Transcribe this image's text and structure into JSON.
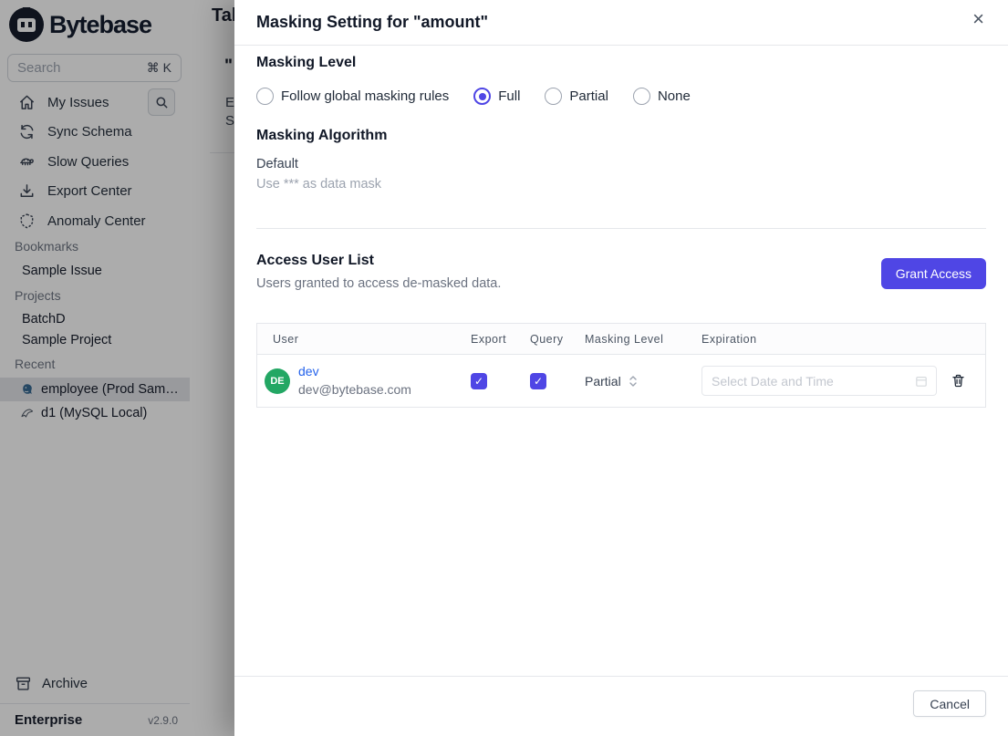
{
  "app": {
    "brand": "Bytebase",
    "plan": "Enterprise",
    "version": "v2.9.0"
  },
  "colors": {
    "accent": "#4f46e5",
    "link_blue": "#2563eb",
    "avatar_green": "#23a764",
    "postgres_blue": "#336791"
  },
  "sidebar": {
    "search": {
      "placeholder": "Search",
      "shortcut": "⌘ K"
    },
    "nav": [
      {
        "label": "My Issues",
        "icon": "home-icon"
      },
      {
        "label": "Sync Schema",
        "icon": "sync-icon"
      },
      {
        "label": "Slow Queries",
        "icon": "turtle-icon"
      },
      {
        "label": "Export Center",
        "icon": "download-icon"
      },
      {
        "label": "Anomaly Center",
        "icon": "shield-icon"
      }
    ],
    "sections": [
      {
        "title": "Bookmarks",
        "items": [
          {
            "label": "Sample Issue"
          }
        ]
      },
      {
        "title": "Projects",
        "items": [
          {
            "label": "BatchD"
          },
          {
            "label": "Sample Project"
          }
        ]
      },
      {
        "title": "Recent",
        "items": [
          {
            "label": "employee (Prod Sam…",
            "icon": "postgres-icon",
            "selected": true
          },
          {
            "label": "d1 (MySQL Local)",
            "icon": "mysql-icon",
            "selected": false
          }
        ]
      }
    ],
    "archive_label": "Archive"
  },
  "background_page": {
    "title_fragment": "Tab",
    "quote_fragment": "\"",
    "row_fragments": [
      "E",
      "S"
    ]
  },
  "modal": {
    "title": "Masking Setting for \"amount\"",
    "masking_level": {
      "heading": "Masking Level",
      "options": [
        {
          "label": "Follow global masking rules",
          "selected": false
        },
        {
          "label": "Full",
          "selected": true
        },
        {
          "label": "Partial",
          "selected": false
        },
        {
          "label": "None",
          "selected": false
        }
      ]
    },
    "masking_algorithm": {
      "heading": "Masking Algorithm",
      "name": "Default",
      "description": "Use *** as data mask"
    },
    "access": {
      "heading": "Access User List",
      "subtitle": "Users granted to access de-masked data.",
      "grant_button": "Grant Access",
      "table": {
        "columns": [
          "User",
          "Export",
          "Query",
          "Masking Level",
          "Expiration"
        ],
        "rows": [
          {
            "avatar_initials": "DE",
            "name": "dev",
            "email": "dev@bytebase.com",
            "export_enabled": true,
            "query_enabled": true,
            "masking_level": "Partial",
            "expiration_placeholder": "Select Date and Time"
          }
        ]
      }
    },
    "footer": {
      "cancel_label": "Cancel"
    }
  }
}
